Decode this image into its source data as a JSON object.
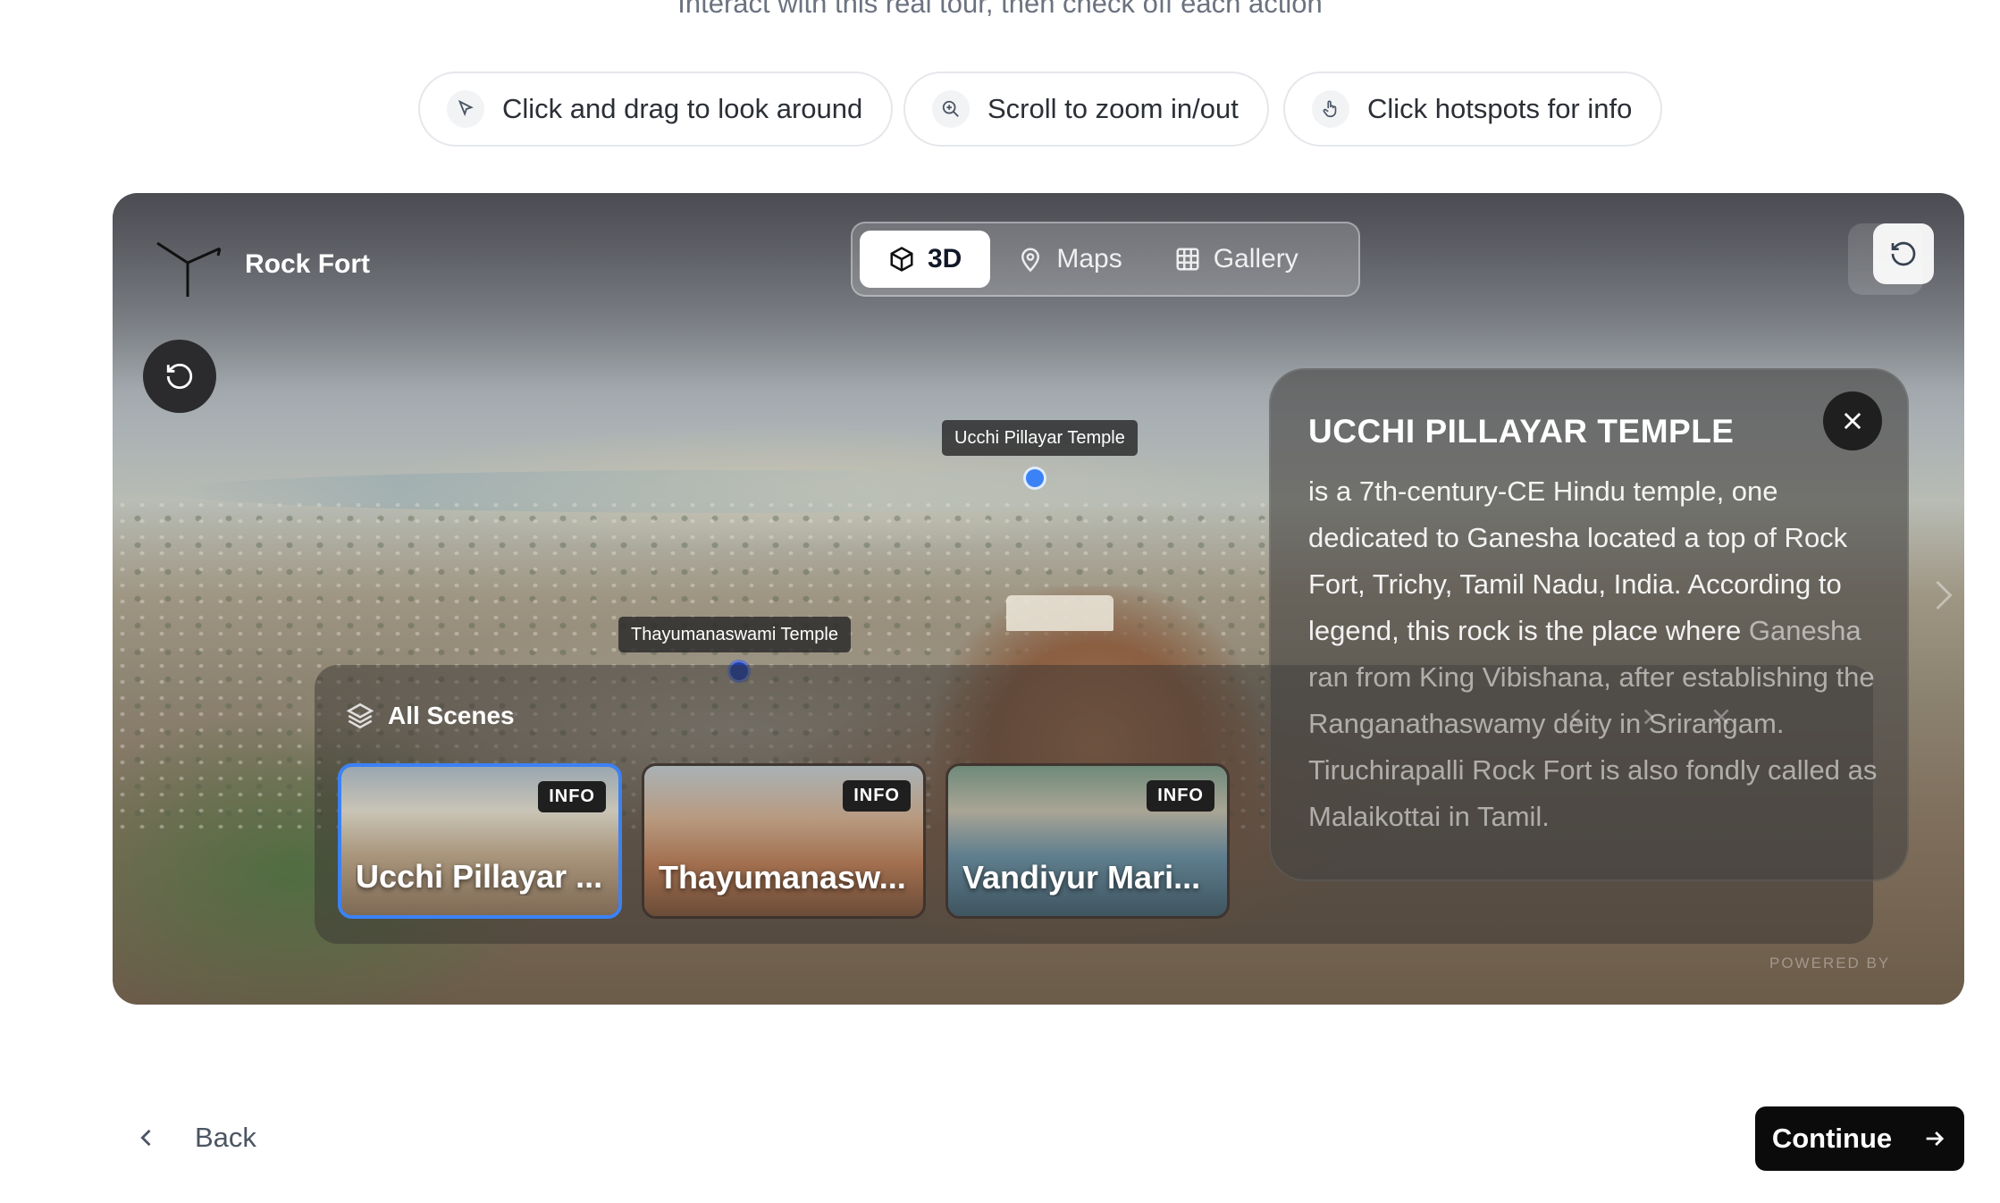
{
  "header": {
    "subtitle": "Interact with this real tour, then check off each action"
  },
  "hints": [
    {
      "label": "Click and drag to look around",
      "icon": "cursor-icon"
    },
    {
      "label": "Scroll to zoom in/out",
      "icon": "zoom-in-icon"
    },
    {
      "label": "Click hotspots for info",
      "icon": "hand-pointer-icon"
    }
  ],
  "viewer": {
    "brand_name": "Rock Fort",
    "tabs": [
      {
        "label": "3D",
        "icon": "cube-icon",
        "active": true
      },
      {
        "label": "Maps",
        "icon": "map-pin-icon",
        "active": false
      },
      {
        "label": "Gallery",
        "icon": "grid-icon",
        "active": false
      }
    ],
    "hotspots": [
      {
        "label": "Ucchi Pillayar Temple"
      },
      {
        "label": "Thayumanaswami Temple"
      }
    ],
    "scenes_panel": {
      "title": "All Scenes",
      "cards": [
        {
          "title": "Ucchi Pillayar ...",
          "badge": "INFO",
          "active": true
        },
        {
          "title": "Thayumanasw...",
          "badge": "INFO",
          "active": false
        },
        {
          "title": "Vandiyur Mari...",
          "badge": "INFO",
          "active": false
        }
      ]
    },
    "info_panel": {
      "title": "UCCHI PILLAYAR TEMPLE",
      "body_visible": "is a 7th-century-CE Hindu temple, one dedicated to Ganesha located a top of Rock Fort, Trichy, Tamil Nadu, India. According to legend, this rock is the place where",
      "body_faded": "Ganesha ran from King Vibishana, after establishing the Ranganathaswamy deity in Srirangam. Tiruchirapalli Rock Fort is also fondly called as Malaikottai in Tamil."
    },
    "powered_by": "POWERED BY"
  },
  "footer": {
    "back_label": "Back",
    "continue_label": "Continue"
  },
  "colors": {
    "accent": "#3b82f6",
    "primary_button": "#0b0b0b"
  }
}
